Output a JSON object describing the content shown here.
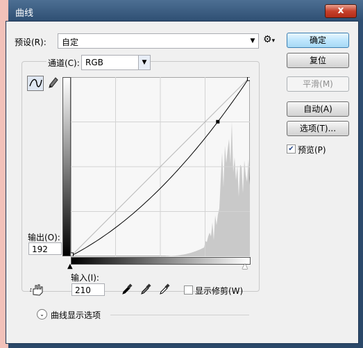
{
  "window": {
    "title": "曲线",
    "close": "x"
  },
  "preset": {
    "label": "预设(R):",
    "value": "自定",
    "options_icon": "gear-icon"
  },
  "buttons": {
    "ok": "确定",
    "reset": "复位",
    "smooth": "平滑(M)",
    "auto": "自动(A)",
    "options": "选项(T)..."
  },
  "preview": {
    "label": "预览(P)",
    "checked": true
  },
  "channel": {
    "label": "通道(C):",
    "value": "RGB"
  },
  "output": {
    "label": "输出(O):",
    "value": "192"
  },
  "input": {
    "label": "输入(I):",
    "value": "210"
  },
  "clipping": {
    "label": "显示修剪(W)",
    "checked": false
  },
  "display_options": {
    "label": "曲线显示选项"
  },
  "curve": {
    "point": [
      210,
      192
    ],
    "endpoints": [
      [
        0,
        0
      ],
      [
        255,
        255
      ]
    ]
  },
  "tools": [
    "curve-tool-icon",
    "pencil-tool-icon",
    "hand-adjust-icon",
    "black-eyedropper-icon",
    "gray-eyedropper-icon",
    "white-eyedropper-icon"
  ]
}
